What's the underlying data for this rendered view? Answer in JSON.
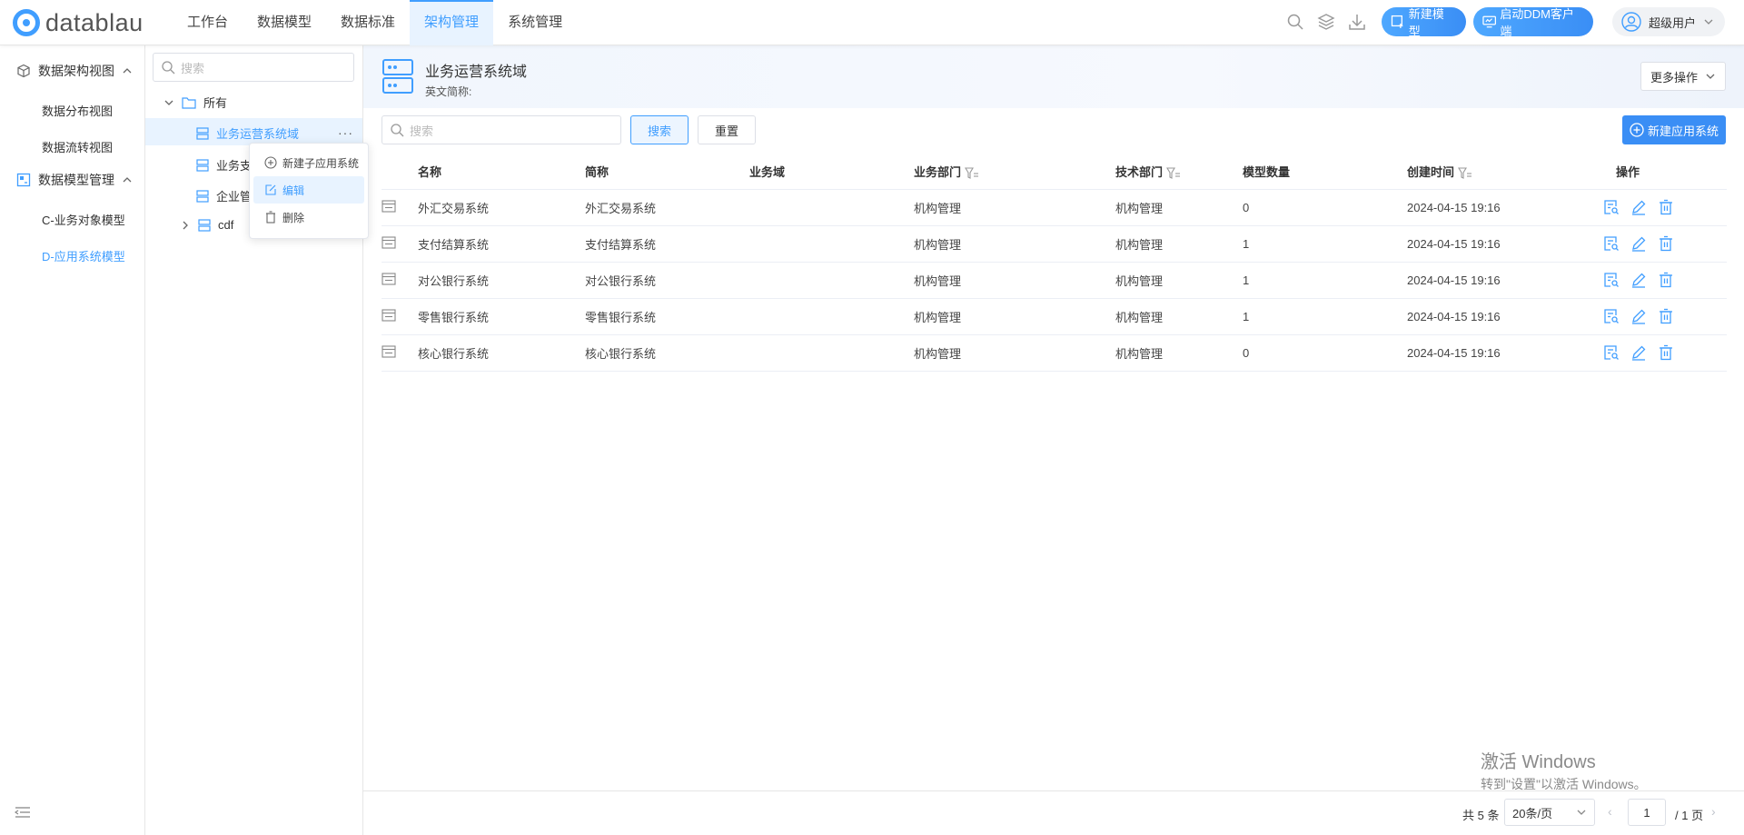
{
  "app": {
    "logo_text": "datablau"
  },
  "nav": {
    "items": [
      "工作台",
      "数据模型",
      "数据标准",
      "架构管理",
      "系统管理"
    ],
    "active_index": 3
  },
  "header": {
    "new_model": "新建模型",
    "ddm_client": "启动DDM客户端",
    "user": "超级用户"
  },
  "sidebar": {
    "groups": [
      {
        "label": "数据架构视图",
        "items": [
          "数据分布视图",
          "数据流转视图"
        ]
      },
      {
        "label": "数据模型管理",
        "items": [
          "C-业务对象模型",
          "D-应用系统模型"
        ]
      }
    ],
    "active_item": "D-应用系统模型"
  },
  "tree": {
    "search_placeholder": "搜索",
    "root": "所有",
    "nodes": [
      "业务运营系统域",
      "业务支",
      "企业管",
      "cdf"
    ],
    "more": "···"
  },
  "context_menu": {
    "items": [
      "新建子应用系统",
      "编辑",
      "删除"
    ],
    "hover_index": 1
  },
  "domain": {
    "title": "业务运营系统域",
    "en_label": "英文简称:",
    "more_ops": "更多操作"
  },
  "toolbar": {
    "search_placeholder": "搜索",
    "search_btn": "搜索",
    "reset_btn": "重置",
    "new_app": "新建应用系统"
  },
  "table": {
    "columns": [
      "名称",
      "简称",
      "业务域",
      "业务部门",
      "技术部门",
      "模型数量",
      "创建时间",
      "操作"
    ],
    "rows": [
      [
        "外汇交易系统",
        "外汇交易系统",
        "",
        "机构管理",
        "机构管理",
        "0",
        "2024-04-15 19:16"
      ],
      [
        "支付结算系统",
        "支付结算系统",
        "",
        "机构管理",
        "机构管理",
        "1",
        "2024-04-15 19:16"
      ],
      [
        "对公银行系统",
        "对公银行系统",
        "",
        "机构管理",
        "机构管理",
        "1",
        "2024-04-15 19:16"
      ],
      [
        "零售银行系统",
        "零售银行系统",
        "",
        "机构管理",
        "机构管理",
        "1",
        "2024-04-15 19:16"
      ],
      [
        "核心银行系统",
        "核心银行系统",
        "",
        "机构管理",
        "机构管理",
        "0",
        "2024-04-15 19:16"
      ]
    ]
  },
  "pagination": {
    "total": "共 5 条",
    "page_size": "20条/页",
    "current": "1",
    "of": "/ 1 页"
  },
  "watermark": {
    "line1": "激活 Windows",
    "line2": "转到\"设置\"以激活 Windows。"
  },
  "colors": {
    "accent": "#409eff",
    "button": "#3a8ef5"
  }
}
